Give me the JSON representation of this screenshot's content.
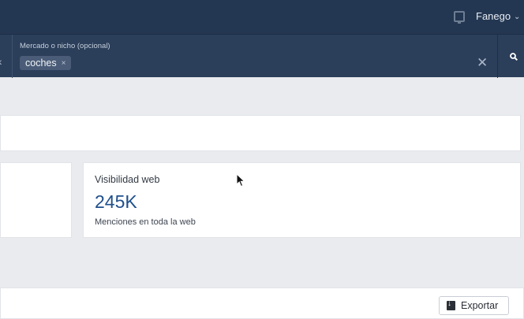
{
  "header": {
    "user_name": "Fanego",
    "user_menu_chevron": "⌄",
    "device_icon": "tablet-icon"
  },
  "filter": {
    "left_chevron": "‹",
    "field_label": "Mercado o nicho (opcional)",
    "tag_value": "coches",
    "tag_remove": "×",
    "clear_symbol": "✕",
    "search_icon": "search-icon"
  },
  "metrics": {
    "visibility": {
      "title": "Visibilidad web",
      "value": "245K",
      "description": "Menciones en toda la web"
    }
  },
  "actions": {
    "export_label": "Exportar",
    "export_icon": "download-icon"
  },
  "colors": {
    "topbar": "#243752",
    "filterbar": "#2b3e5a",
    "metric_value": "#1f4f8c",
    "page_background": "#e9ebee"
  }
}
